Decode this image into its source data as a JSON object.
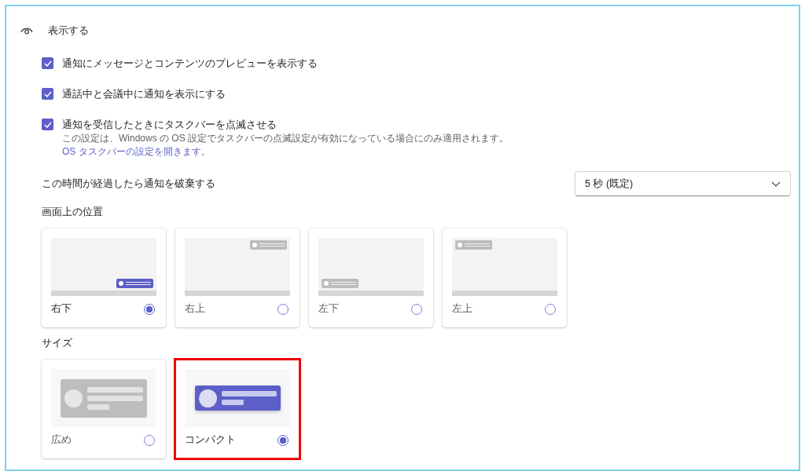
{
  "section": {
    "title": "表示する"
  },
  "checkboxes": [
    {
      "label": "通知にメッセージとコンテンツのプレビューを表示する",
      "checked": true
    },
    {
      "label": "通話中と会議中に通知を表示にする",
      "checked": true
    },
    {
      "label": "通知を受信したときにタスクバーを点滅させる",
      "checked": true,
      "note": "この設定は、Windows の OS 設定でタスクバーの点滅設定が有効になっている場合にのみ適用されます。",
      "link": "OS タスクバーの設定を開きます。"
    }
  ],
  "dismiss": {
    "label": "この時間が経過したら通知を破棄する",
    "value": "5 秒 (既定)"
  },
  "position": {
    "label": "画面上の位置",
    "options": [
      {
        "label": "右下",
        "kind": "bottom-right",
        "selected": true
      },
      {
        "label": "右上",
        "kind": "top-right",
        "selected": false
      },
      {
        "label": "左下",
        "kind": "bottom-left",
        "selected": false
      },
      {
        "label": "左上",
        "kind": "top-left",
        "selected": false
      }
    ]
  },
  "size": {
    "label": "サイズ",
    "options": [
      {
        "label": "広め",
        "kind": "large",
        "selected": false,
        "highlighted": false
      },
      {
        "label": "コンパクト",
        "kind": "compact",
        "selected": true,
        "highlighted": true
      }
    ]
  }
}
